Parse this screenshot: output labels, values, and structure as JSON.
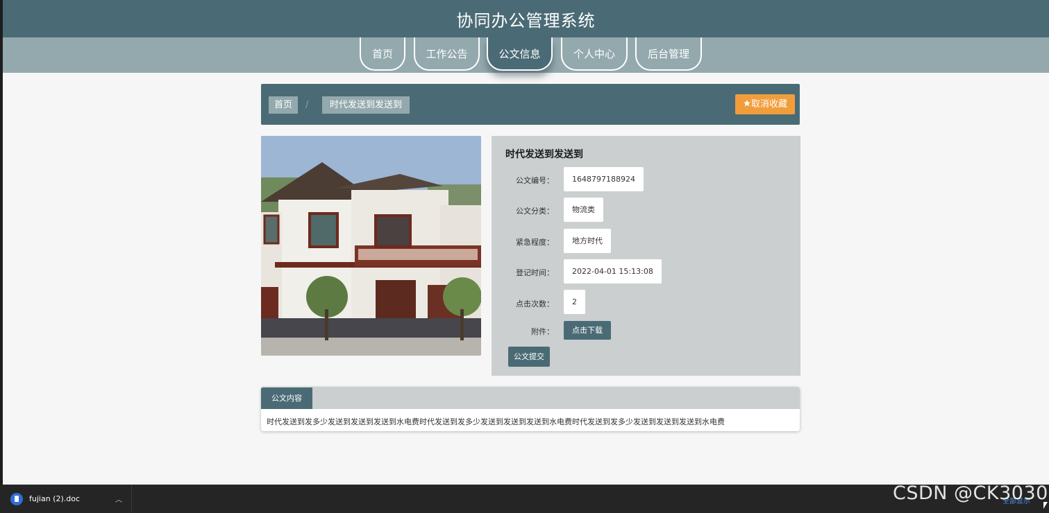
{
  "site": {
    "title": "协同办公管理系统"
  },
  "nav": {
    "items": [
      {
        "label": "首页"
      },
      {
        "label": "工作公告"
      },
      {
        "label": "公文信息"
      },
      {
        "label": "个人中心"
      },
      {
        "label": "后台管理"
      }
    ],
    "active_label": "公文信息"
  },
  "breadcrumb": {
    "home": "首页",
    "separator": "/",
    "current": "时代发送到发送到"
  },
  "favorite_button": {
    "icon": "star-icon",
    "label": "取消收藏"
  },
  "detail": {
    "title": "时代发送到发送到",
    "fields": [
      {
        "label": "公文编号：",
        "value": "1648797188924"
      },
      {
        "label": "公文分类：",
        "value": "物流类"
      },
      {
        "label": "紧急程度：",
        "value": "地方时代"
      },
      {
        "label": "登记时间：",
        "value": "2022-04-01 15:13:08"
      },
      {
        "label": "点击次数：",
        "value": "2"
      }
    ],
    "attachment_label": "附件：",
    "download_label": "点击下载",
    "submit_label": "公文提交"
  },
  "content": {
    "tab_label": "公文内容",
    "text": "时代发送到发多少发送到发送到发送到水电费时代发送到发多少发送到发送到发送到水电费时代发送到发多少发送到发送到发送到水电费"
  },
  "download_bar": {
    "file_name": "fujian (2).doc",
    "show_all": "全部显示"
  },
  "watermark": "CSDN @CK3030",
  "colors": {
    "primary": "#4a6b75",
    "nav_bg": "#93a9ad",
    "accent": "#f29d3b",
    "detail_bg": "#cbcfcf"
  }
}
